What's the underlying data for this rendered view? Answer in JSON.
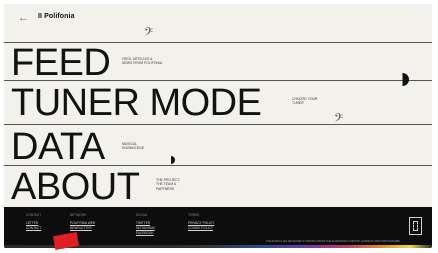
{
  "header": {
    "back_label": "←",
    "brand": "II Polifonia"
  },
  "menu": [
    {
      "label": "FEED",
      "desc": [
        "FEED, ARTICLES &",
        "NEWS FROM POLIFONIA"
      ]
    },
    {
      "label": "TUNER MODE",
      "desc": [
        "CHOOSE YOUR",
        "TUNER"
      ]
    },
    {
      "label": "DATA",
      "desc": [
        "MUSICAL",
        "KNOWLEDGE"
      ]
    },
    {
      "label": "ABOUT",
      "desc": [
        "THE PROJECT,",
        "THE TEAM &",
        "PARTNERS"
      ]
    }
  ],
  "footer": {
    "columns": [
      {
        "heading": "CONTACT",
        "links": [
          "LETTER",
          "CONTACT"
        ]
      },
      {
        "heading": "NETWORK",
        "links": [
          "POLIFONIA WEB",
          "NEWSLETTER"
        ]
      },
      {
        "heading": "SOCIAL",
        "links": [
          "TWITTER",
          "INSTAGRAM",
          "FACEBOOK"
        ]
      },
      {
        "heading": "TERMS",
        "links": [
          "PRIVACY POLICY",
          "COOKIE POLICY"
        ]
      }
    ],
    "copyright": "POLIFONIA HAS RECEIVED FUNDING FROM THE EUROPEAN UNION'S HORIZON 2020 PROGRAMME"
  },
  "colors": {
    "background": "#f3f1ec",
    "footer_bg": "#0d0d0d",
    "accent_red": "#e01f25"
  }
}
